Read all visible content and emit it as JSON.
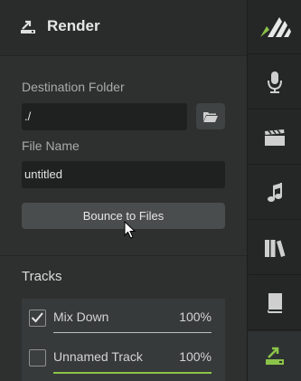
{
  "header": {
    "title": "Render",
    "icon": "export-icon"
  },
  "form": {
    "destination_label": "Destination Folder",
    "destination_value": "./",
    "filename_label": "File Name",
    "filename_value": "untitled",
    "bounce_label": "Bounce to Files"
  },
  "tracks": {
    "title": "Tracks",
    "items": [
      {
        "name": "Mix Down",
        "percent": "100%",
        "checked": true
      },
      {
        "name": "Unnamed Track",
        "percent": "100%",
        "checked": false
      }
    ]
  },
  "sidebar": {
    "items": [
      "logo",
      "microphone-icon",
      "clapperboard-icon",
      "music-note-icon",
      "library-icon",
      "book-icon",
      "export-icon"
    ],
    "active": "export-icon"
  },
  "colors": {
    "accent": "#8bc34a",
    "background": "#2e3030"
  }
}
